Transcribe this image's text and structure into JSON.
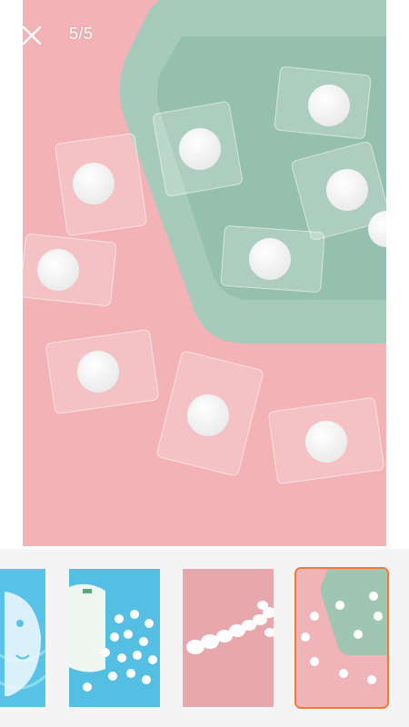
{
  "viewer": {
    "counter": "5/5",
    "close_icon": "close-icon",
    "main_image": "pink-background-tray-with-wrapped-compressed-mask-tablets"
  },
  "thumbnails": [
    {
      "name": "thumb-blue-water-face-mask",
      "active": false
    },
    {
      "name": "thumb-blue-tablets-pouch",
      "active": false
    },
    {
      "name": "thumb-pink-tablets-row",
      "active": false
    },
    {
      "name": "thumb-pink-tray-tablets",
      "active": true
    }
  ],
  "colors": {
    "accent": "#f07a30",
    "pink": "#f0b3b7",
    "tray": "#9fc5b3",
    "blue": "#52bde0"
  }
}
